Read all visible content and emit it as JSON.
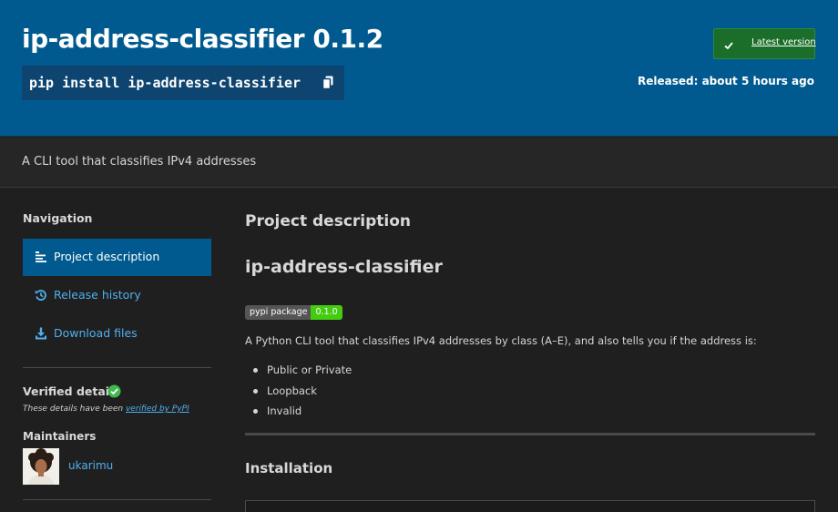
{
  "header": {
    "package_title": "ip-address-classifier 0.1.2",
    "pip_command": "pip install ip-address-classifier",
    "copy_icon": "copy-icon",
    "latest_version_label": "Latest version",
    "released_text": "Released: about 5 hours ago"
  },
  "summary": "A CLI tool that classifies IPv4 addresses",
  "sidebar": {
    "navigation_heading": "Navigation",
    "items": [
      {
        "label": "Project description",
        "icon": "align-left-icon",
        "active": true
      },
      {
        "label": "Release history",
        "icon": "history-icon",
        "active": false
      },
      {
        "label": "Download files",
        "icon": "download-icon",
        "active": false
      }
    ],
    "verified_heading": "Verified details",
    "verified_note_prefix": "These details have been ",
    "verified_note_link": "verified by PyPI",
    "maintainers_heading": "Maintainers",
    "maintainer_name": "ukarimu"
  },
  "main": {
    "section_title": "Project description",
    "readme_title": "ip-address-classifier",
    "badge": {
      "label": "pypi package",
      "value": "0.1.0"
    },
    "intro": "A Python CLI tool that classifies IPv4 addresses by class (A–E), and also tells you if the address is:",
    "bullets": [
      "Public or Private",
      "Loopback",
      "Invalid"
    ],
    "installation_heading": "Installation"
  },
  "colors": {
    "hero_bg": "#005a8f",
    "latest_green": "#1b6e2a",
    "link_blue": "#4fb0f0",
    "page_bg": "#1f1f1f"
  }
}
